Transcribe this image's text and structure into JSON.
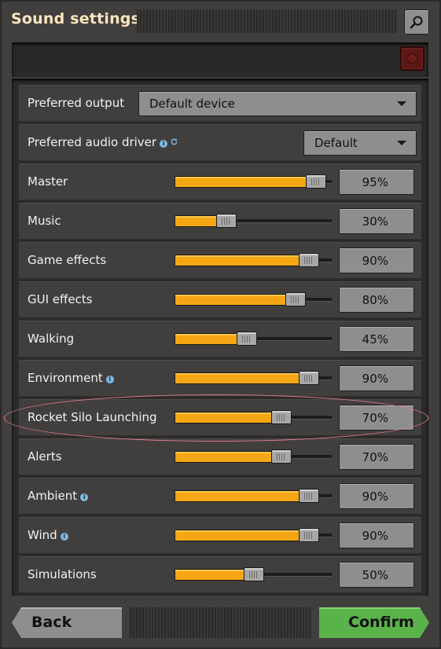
{
  "window": {
    "title": "Sound settings"
  },
  "settings": {
    "preferred_output": {
      "label": "Preferred output",
      "value": "Default device"
    },
    "audio_driver": {
      "label": "Preferred audio driver",
      "value": "Default"
    },
    "sliders": [
      {
        "label": "Master",
        "value": "95%",
        "level": 0.95,
        "info": false
      },
      {
        "label": "Music",
        "value": "30%",
        "level": 0.3,
        "info": false
      },
      {
        "label": "Game effects",
        "value": "90%",
        "level": 0.9,
        "info": false
      },
      {
        "label": "GUI effects",
        "value": "80%",
        "level": 0.8,
        "info": false
      },
      {
        "label": "Walking",
        "value": "45%",
        "level": 0.45,
        "info": false
      },
      {
        "label": "Environment",
        "value": "90%",
        "level": 0.9,
        "info": true
      },
      {
        "label": "Rocket Silo Launching",
        "value": "70%",
        "level": 0.7,
        "info": false,
        "highlighted": true
      },
      {
        "label": "Alerts",
        "value": "70%",
        "level": 0.7,
        "info": false
      },
      {
        "label": "Ambient",
        "value": "90%",
        "level": 0.9,
        "info": true
      },
      {
        "label": "Wind",
        "value": "90%",
        "level": 0.9,
        "info": true
      },
      {
        "label": "Simulations",
        "value": "50%",
        "level": 0.5,
        "info": false
      }
    ]
  },
  "footer": {
    "back_label": "Back",
    "confirm_label": "Confirm"
  },
  "colors": {
    "slider_fill": "#f5a614",
    "confirm": "#5ab24a",
    "title": "#ffe6c0",
    "highlight": "#e07a93"
  }
}
